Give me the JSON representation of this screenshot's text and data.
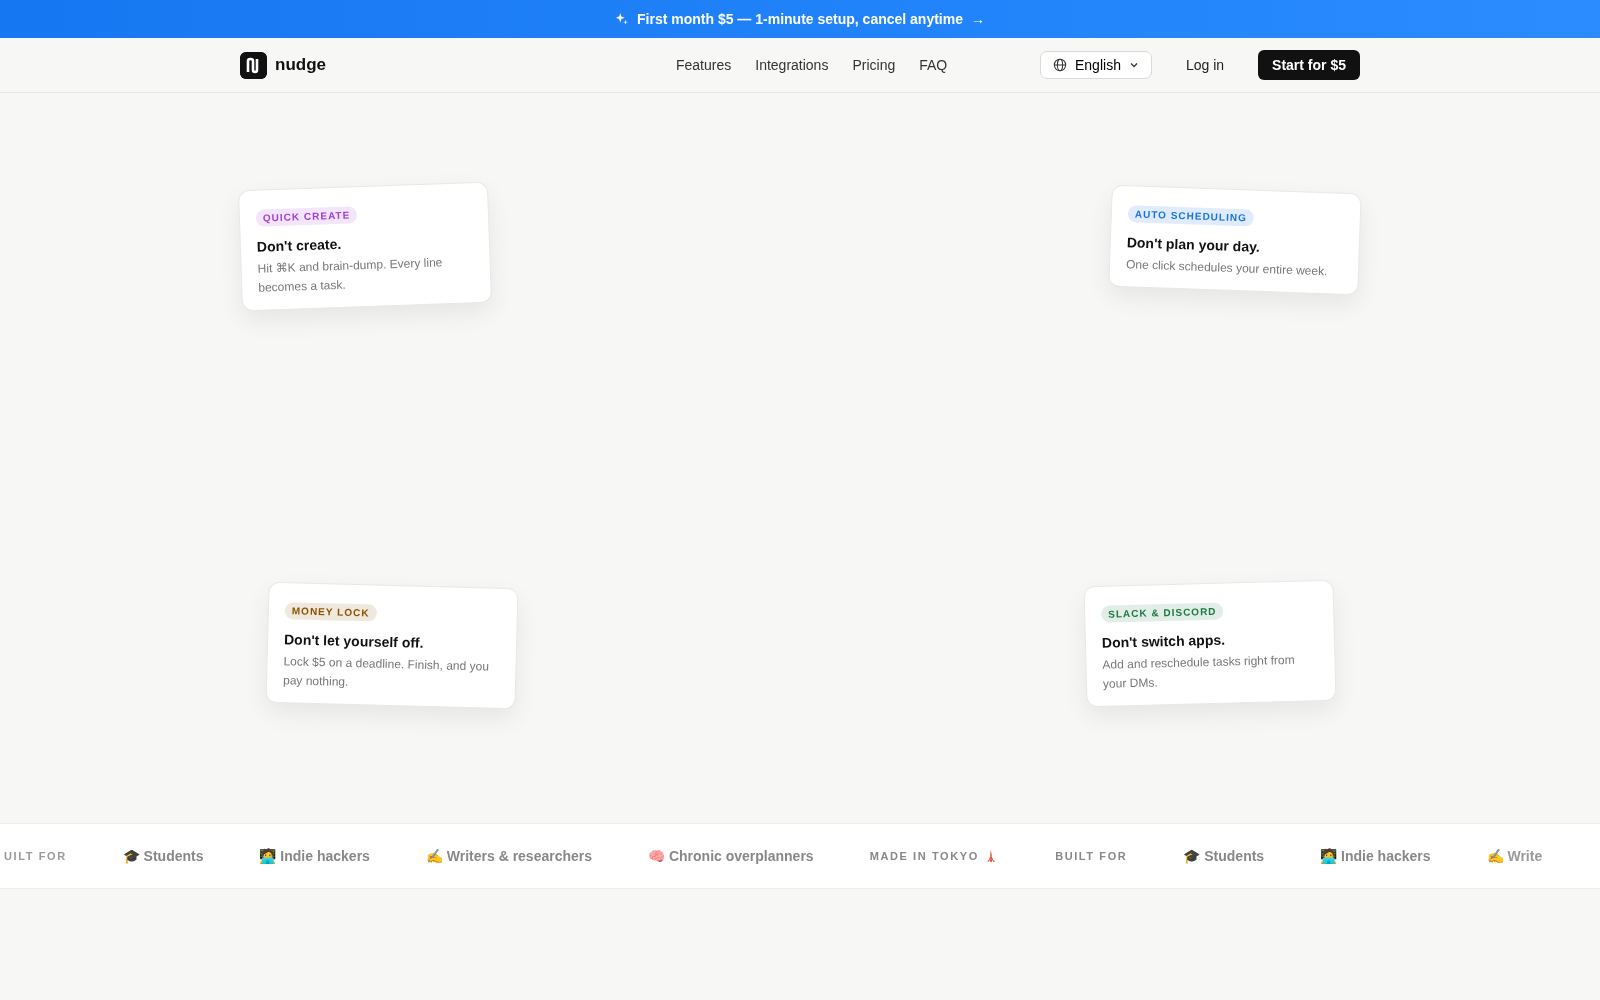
{
  "announcement": {
    "text": "First month $5 — 1-minute setup, cancel anytime",
    "arrow": "→"
  },
  "navbar": {
    "brand": "nudge",
    "links": [
      "Features",
      "Integrations",
      "Pricing",
      "FAQ"
    ],
    "language": "English",
    "login": "Log in",
    "cta": "Start for $5"
  },
  "cards": [
    {
      "tag": "QUICK CREATE",
      "color": "#a23fd6",
      "title": "Don't create.",
      "text": "Hit ⌘K and brain-dump. Every line becomes a task."
    },
    {
      "tag": "AUTO SCHEDULING",
      "color": "#1a73e8",
      "title": "Don't plan your day.",
      "text": "One click schedules your entire week."
    },
    {
      "tag": "MONEY LOCK",
      "color": "#8a5300",
      "title": "Don't let yourself off.",
      "text": "Lock $5 on a deadline. Finish, and you pay nothing."
    },
    {
      "tag": "SLACK & DISCORD",
      "color": "#1e7a45",
      "title": "Don't switch apps.",
      "text": "Add and reschedule tasks right from your DMs."
    }
  ],
  "marquee": [
    {
      "kind": "label",
      "text": "UILT FOR"
    },
    {
      "kind": "audience",
      "text": "🎓 Students"
    },
    {
      "kind": "audience",
      "text": "🧑‍💻 Indie hackers"
    },
    {
      "kind": "audience",
      "text": "✍️ Writers & researchers"
    },
    {
      "kind": "audience",
      "text": "🧠 Chronic overplanners"
    },
    {
      "kind": "label",
      "text": "MADE IN TOKYO 🗼"
    },
    {
      "kind": "label",
      "text": "BUILT FOR"
    },
    {
      "kind": "audience",
      "text": "🎓 Students"
    },
    {
      "kind": "audience",
      "text": "🧑‍💻 Indie hackers"
    },
    {
      "kind": "audience",
      "text": "✍️ Write"
    }
  ]
}
